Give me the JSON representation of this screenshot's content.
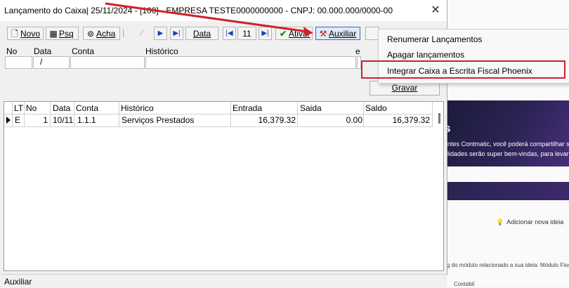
{
  "window": {
    "title": "Lançamento do Caixa|  25/11/2024 - [100] - EMPRESA TESTE0000000000 - CNPJ: 00.000.000/0000-00",
    "close_glyph": "✕"
  },
  "toolbar": {
    "novo_label": "Novo",
    "psq_label": "Psq",
    "acha_label": "Acha",
    "data_label": "Data",
    "page_number": "11",
    "ativar_label": "Ativar",
    "auxiliar_label": "Auxiliar"
  },
  "entry_form": {
    "headers": {
      "no": "No",
      "data": "Data",
      "conta": "Conta",
      "historico": "Histórico",
      "extra": "e"
    },
    "data_value": "/",
    "gravar_label": "Gravar"
  },
  "grid": {
    "columns": [
      "LT",
      "No",
      "Data",
      "Conta",
      "Histórico",
      "Entrada",
      "Saida",
      "Saldo"
    ],
    "rows": [
      {
        "lt": "E",
        "no": "1",
        "data": "10/11",
        "conta": "1.1.1",
        "historico": "Serviços Prestados",
        "entrada": "16,379.32",
        "saida": "0.00",
        "saldo": "16,379.32"
      }
    ]
  },
  "menu": {
    "items": [
      "Renumerar Lançamentos",
      "Apagar lançamentos",
      "Integrar Caixa a Escrita Fiscal Phoenix"
    ],
    "highlight_color": "#d0202a"
  },
  "status_bar": {
    "text": "Auxiliar"
  },
  "background": {
    "banner_big": "s",
    "banner_line1": "entes Contmatic, você poderá compartilhar su",
    "banner_line2": "alidades serão super bem-vindas, para levarm",
    "idea_label": "Adicionar nova ideia",
    "modulo_text": "g do módulo relacionado a sua ideia: Módulo Fiscal,",
    "contabil_text": "Contábil",
    "left_letter": "n",
    "left_small": [
      "c",
      "r",
      "c"
    ]
  }
}
